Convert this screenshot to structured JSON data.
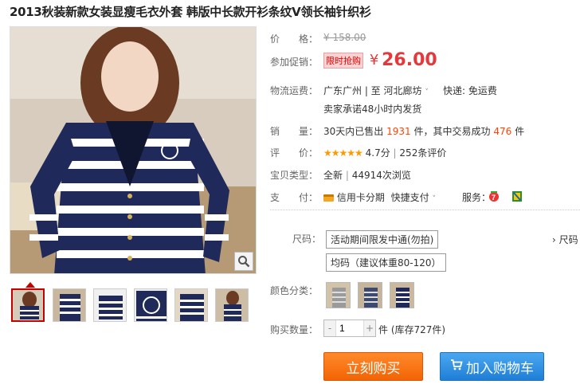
{
  "title": "2013秋装新款女装显瘦毛衣外套 韩版中长款开衫条纹V领长袖针织衫",
  "price": {
    "label": "价　　格：",
    "original": "¥ 158.00",
    "promo_label": "参加促销：",
    "promo_badge": "限时抢购",
    "currency": "¥",
    "current": "26.00"
  },
  "shipping": {
    "label": "物流运费：",
    "route": "广东广州 | 至 河北廊坊",
    "express": "快递: 免运费",
    "promise": "卖家承诺48小时内发货"
  },
  "sales": {
    "label": "销　　量：",
    "prefix": "30天内已售出",
    "sold": "1931",
    "mid": "件，其中交易成功",
    "success": "476",
    "suffix": "件"
  },
  "rating": {
    "label": "评　　价：",
    "stars": "★★★★★",
    "score": "4.7分",
    "reviews": "252条评价"
  },
  "type": {
    "label": "宝贝类型：",
    "value": "全新",
    "views": "44914次浏览"
  },
  "payment": {
    "label": "支　　付：",
    "method1": "信用卡分期",
    "method2": "快捷支付",
    "service_label": "服务："
  },
  "size": {
    "label": "尺码：",
    "options": [
      "活动期间限发中通(勿拍)",
      "均码（建议体重80-120）"
    ],
    "side_link": "› 尺码"
  },
  "color": {
    "label": "颜色分类："
  },
  "quantity": {
    "label": "购买数量：",
    "value": "1",
    "minus": "-",
    "plus": "+",
    "stock": "件 (库存727件)"
  },
  "buttons": {
    "buy": "立刻购买",
    "cart": "加入购物车"
  },
  "colors": {
    "price_red": "#e4393c",
    "orange": "#ff6600",
    "navy": "#1f2a5a",
    "buy_orange": "#f26405",
    "cart_blue": "#1f7fd6"
  }
}
